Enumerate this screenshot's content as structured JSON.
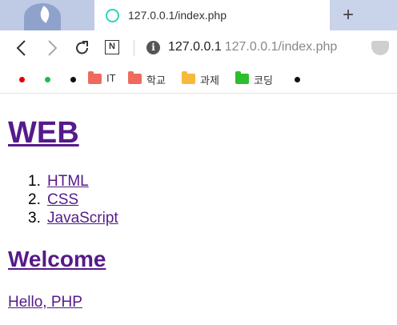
{
  "tab": {
    "title": "127.0.0.1/index.php",
    "new_tab_symbol": "+"
  },
  "address": {
    "host": "127.0.0.1",
    "rest": "127.0.0.1/index.php",
    "naver_label": "N"
  },
  "bookmarks": {
    "dots": [
      "#e00000",
      "#1db954",
      "#111111"
    ],
    "folders": [
      {
        "label": "IT",
        "color": "#ef6a5e"
      },
      {
        "label": "학교",
        "color": "#ef6a5e"
      },
      {
        "label": "과제",
        "color": "#f6b93b"
      },
      {
        "label": "코딩",
        "color": "#2ebd2e"
      }
    ]
  },
  "page": {
    "title": "WEB",
    "list": [
      {
        "num": "1.",
        "label": "HTML"
      },
      {
        "num": "2.",
        "label": "CSS"
      },
      {
        "num": "3.",
        "label": "JavaScript"
      }
    ],
    "heading": "Welcome",
    "paragraph_link": "Hello, PHP"
  }
}
